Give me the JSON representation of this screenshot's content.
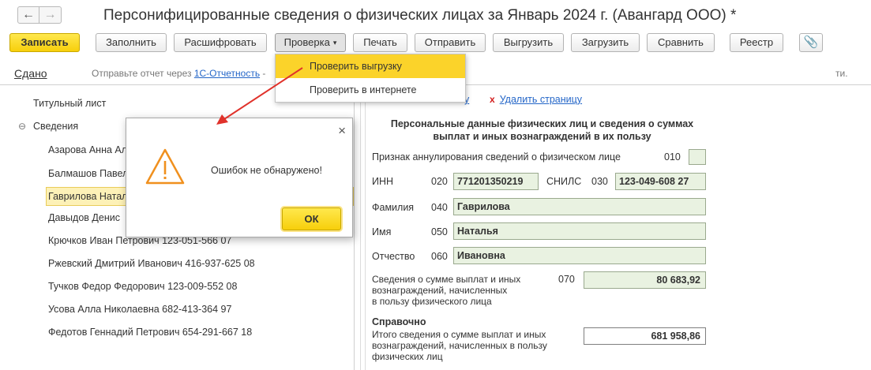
{
  "window": {
    "back_label": "←",
    "forward_label": "→",
    "title": "Персонифицированные сведения о физических лицах за Январь 2024 г. (Авангард ООО) *"
  },
  "toolbar": {
    "save": "Записать",
    "fill": "Заполнить",
    "decode": "Расшифровать",
    "check": "Проверка",
    "print": "Печать",
    "send": "Отправить",
    "export": "Выгрузить",
    "import": "Загрузить",
    "compare": "Сравнить",
    "registry": "Реестр",
    "attach_icon": "paperclip-icon"
  },
  "check_menu": {
    "items": [
      "Проверить выгрузку",
      "Проверить в интернете"
    ],
    "highlighted": 0
  },
  "infobar": {
    "status": "Сдано",
    "text_before": "Отправьте отчет через ",
    "link": "1С-Отчетность",
    "text_after": " -",
    "tail": "ти."
  },
  "tree": {
    "title_page": "Титульный лист",
    "section": "Сведения",
    "section_toggle": "⊖",
    "persons": [
      "Азарова Анна Ал",
      "Балмашов Павел",
      "Гаврилова Натал",
      "Давыдов Денис",
      "Крючков Иван Петрович 123-051-566 07",
      "Ржевский Дмитрий Иванович 416-937-625 08",
      "Тучков Федор Федорович 123-009-552 08",
      "Усова Алла Николаевна 682-413-364 97",
      "Федотов Геннадий Петрович 654-291-667 18"
    ],
    "selected": 2
  },
  "form": {
    "link_partial": "у",
    "delete_icon": "x",
    "delete_link": "Удалить страницу",
    "heading": "Персональные данные физических лиц и сведения о суммах выплат и иных вознаграждений в их пользу",
    "annul_label": "Признак аннулирования сведений о физическом лице",
    "annul_code": "010",
    "inn_label": "ИНН",
    "inn_code": "020",
    "inn": "771201350219",
    "snils_label": "СНИЛС",
    "snils_code": "030",
    "snils": "123-049-608 27",
    "last_name_label": "Фамилия",
    "last_name_code": "040",
    "last_name": "Гаврилова",
    "first_name_label": "Имя",
    "first_name_code": "050",
    "first_name": "Наталья",
    "patronymic_label": "Отчество",
    "patronymic_code": "060",
    "patronymic": "Ивановна",
    "payments_label_lines": [
      "Сведения о сумме выплат и иных",
      "вознаграждений, начисленных",
      "в пользу физического лица"
    ],
    "payments_code": "070",
    "payments": "80 683,92",
    "reference_title": "Справочно",
    "total_label_lines": [
      "Итого сведения о сумме выплат и иных",
      "вознаграждений, начисленных в пользу",
      "физических лиц"
    ],
    "total": "681 958,86"
  },
  "dialog": {
    "close_icon": "×",
    "message": "Ошибок не обнаружено!",
    "ok": "ОК"
  },
  "colors": {
    "accent_yellow": "#f7cf0b",
    "field_green": "#e9f2e1",
    "link_blue": "#2466c8",
    "arrow_red": "#e0322b",
    "warning_orange": "#f0901e"
  }
}
